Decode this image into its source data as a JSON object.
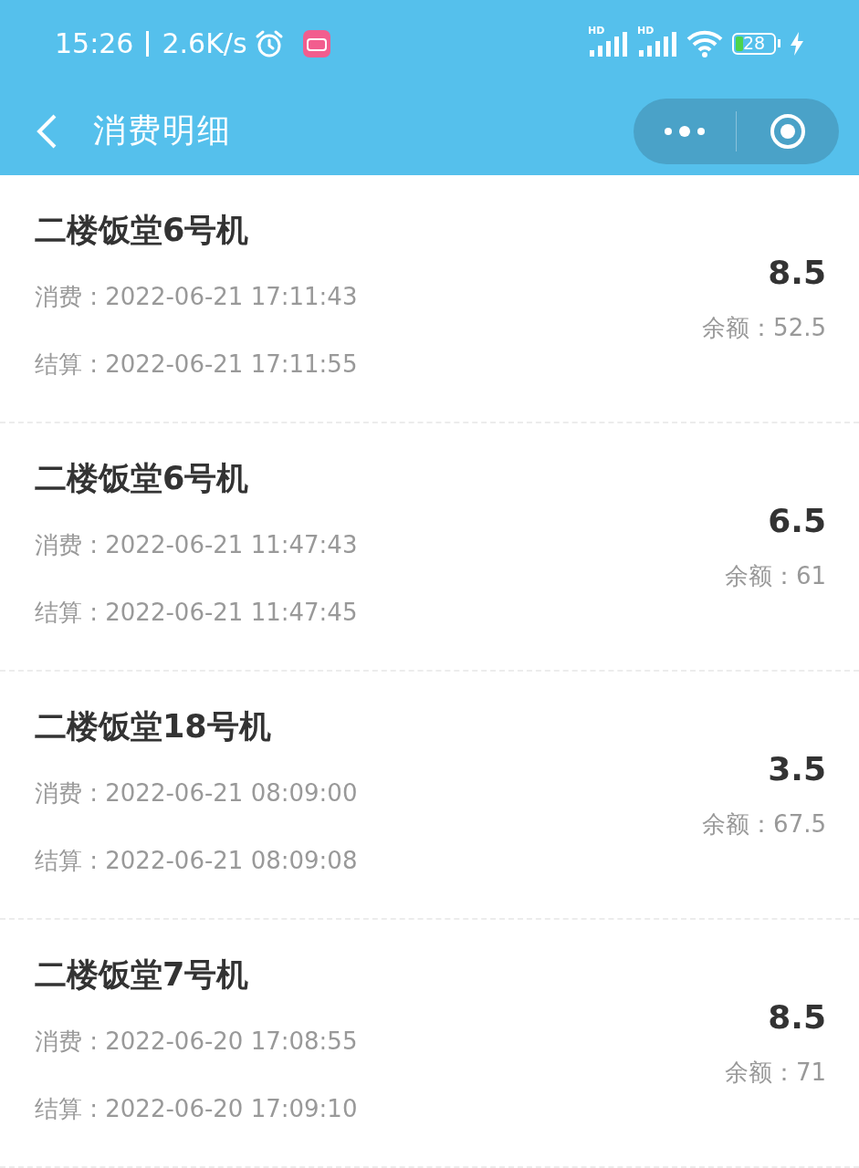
{
  "status_bar": {
    "time": "15:26",
    "speed": "2.6K/s",
    "signals": [
      {
        "label": "HD"
      },
      {
        "label": "HD"
      }
    ],
    "battery": "28"
  },
  "nav_bar": {
    "title": "消费明细"
  },
  "records": [
    {
      "title": "二楼饭堂6号机",
      "consumed": "消费 : 2022-06-21 17:11:43",
      "settled": "结算 : 2022-06-21 17:11:55",
      "amount": "8.5",
      "balance": "余额：52.5"
    },
    {
      "title": "二楼饭堂6号机",
      "consumed": "消费 : 2022-06-21 11:47:43",
      "settled": "结算 : 2022-06-21 11:47:45",
      "amount": "6.5",
      "balance": "余额：61"
    },
    {
      "title": "二楼饭堂18号机",
      "consumed": "消费 : 2022-06-21 08:09:00",
      "settled": "结算 : 2022-06-21 08:09:08",
      "amount": "3.5",
      "balance": "余额：67.5"
    },
    {
      "title": "二楼饭堂7号机",
      "consumed": "消费 : 2022-06-20 17:08:55",
      "settled": "结算 : 2022-06-20 17:09:10",
      "amount": "8.5",
      "balance": "余额：71"
    }
  ]
}
